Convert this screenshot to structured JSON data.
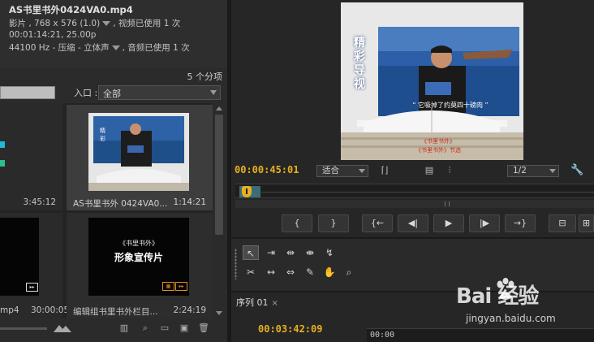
{
  "project_panel": {
    "clip_info": {
      "title": "AS书里书外0424VA0.mp4",
      "line1_a": "影片 , 768 x 576 (1.0)",
      "line1_b": ", 视频已使用 1 次",
      "line2": "00:01:14:21, 25.00p",
      "line3_a": "44100 Hz - 压缩 - 立体声",
      "line3_b": ", 音频已使用 1 次"
    },
    "item_count": "5 个分项",
    "entry_label": "入口 :",
    "entry_value": "全部",
    "items": [
      {
        "name": "",
        "duration": "3:45:12"
      },
      {
        "name": "AS书里书外 0424VA0...",
        "duration": "1:14:21"
      },
      {
        "name": "mp4",
        "duration": "30:00:05"
      },
      {
        "name": "编辑组书里书外栏目...",
        "duration": "2:24:19",
        "thumb_line1": "《书里书外》",
        "thumb_line2": "形象宣传片"
      }
    ],
    "footer_icons": [
      "list-view-icon",
      "search-icon",
      "new-bin-icon",
      "new-item-icon",
      "delete-icon"
    ]
  },
  "program_monitor": {
    "frame": {
      "title_vertical": "精彩导视",
      "caption": "“ 它吸掉了约莫四十磅肉 ”",
      "book_line1": "《书里书外》",
      "book_line2": "《书里书外》节选"
    },
    "timecode": "00:00:45:01",
    "fit_value": "适合",
    "resolution_value": "1/2",
    "transport": [
      "{",
      "}",
      "{←",
      "◀|",
      "▶",
      "|▶",
      "→}",
      "lift",
      "extract"
    ]
  },
  "sequence": {
    "tab_label": "序列 01",
    "timecode": "00:03:42:09",
    "ruler_start": "00:00"
  },
  "watermark": {
    "logo_text": "Bai 经验",
    "url": "jingyan.baidu.com"
  },
  "colors": {
    "timecode": "#e8b021",
    "panel_bg": "#2b2b2b",
    "accent_cyan": "#22b8d8",
    "accent_green": "#2ac08a"
  }
}
